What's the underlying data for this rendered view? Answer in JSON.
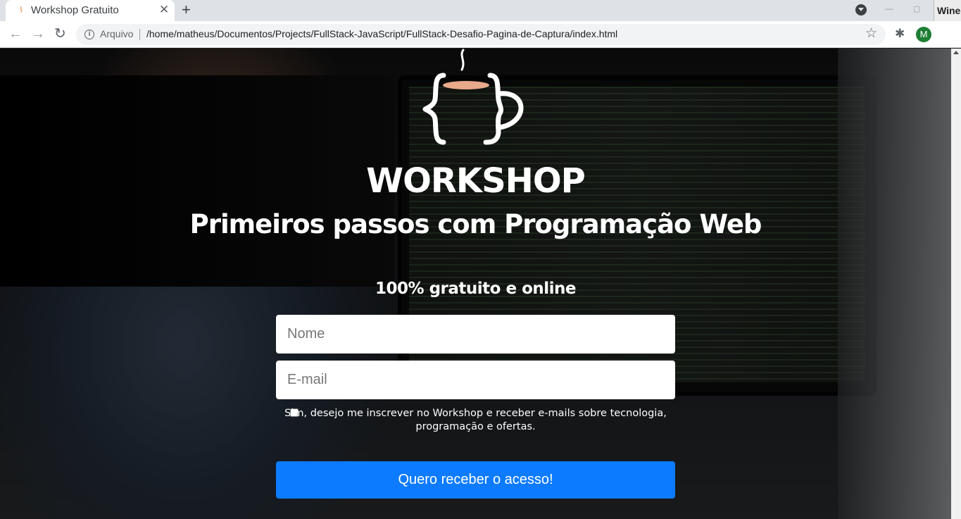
{
  "browser": {
    "tab_title": "Workshop Gratuito",
    "tab_close": "✕",
    "new_tab": "+",
    "scheme_label": "Arquivo",
    "url": "/home/matheus/Documentos/Projects/FullStack-JavaScript/FullStack-Desafio-Pagina-de-Captura/index.html",
    "avatar_initial": "M",
    "back_icon": "←",
    "forward_icon": "→",
    "reload_icon": "↻",
    "star_icon": "☆",
    "extensions_icon": "✱",
    "minimize_icon": "—",
    "maximize_icon": "▢"
  },
  "wine_popup": {
    "label": "Wine"
  },
  "page": {
    "headline": "WORKSHOP",
    "subheadline": "Primeiros passos com Programação Web",
    "tagline": "100% gratuito e online",
    "form": {
      "name_placeholder": "Nome",
      "email_placeholder": "E-mail",
      "consent_text": "Sim, desejo me inscrever no Workshop e receber e-mails sobre tecnologia, programação e ofertas.",
      "submit_label": "Quero receber o acesso!"
    },
    "colors": {
      "accent": "#0d7bff",
      "logo_cup": "#e9a98b"
    }
  }
}
